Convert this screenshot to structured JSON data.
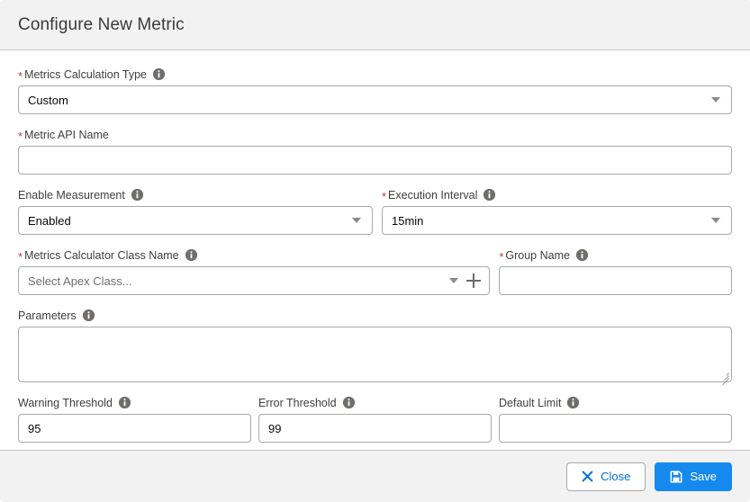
{
  "header": {
    "title": "Configure New Metric"
  },
  "form": {
    "metrics_calculation_type": {
      "label": "Metrics Calculation Type",
      "required": true,
      "has_info": true,
      "value": "Custom",
      "control": "select"
    },
    "metric_api_name": {
      "label": "Metric API Name",
      "required": true,
      "has_info": false,
      "value": "",
      "placeholder": "",
      "control": "text"
    },
    "enable_measurement": {
      "label": "Enable Measurement",
      "required": false,
      "has_info": true,
      "value": "Enabled",
      "control": "select"
    },
    "execution_interval": {
      "label": "Execution Interval",
      "required": true,
      "has_info": true,
      "value": "15min",
      "control": "select"
    },
    "metrics_calculator_class_name": {
      "label": "Metrics Calculator Class Name",
      "required": true,
      "has_info": true,
      "value": "",
      "placeholder": "Select Apex Class...",
      "control": "lookup",
      "add_button": "+"
    },
    "group_name": {
      "label": "Group Name",
      "required": true,
      "has_info": true,
      "value": "",
      "placeholder": "",
      "control": "text"
    },
    "parameters": {
      "label": "Parameters",
      "required": false,
      "has_info": true,
      "value": "",
      "placeholder": "",
      "control": "textarea"
    },
    "warning_threshold": {
      "label": "Warning Threshold",
      "required": false,
      "has_info": true,
      "value": "95",
      "control": "text"
    },
    "error_threshold": {
      "label": "Error Threshold",
      "required": false,
      "has_info": true,
      "value": "99",
      "control": "text"
    },
    "default_limit": {
      "label": "Default Limit",
      "required": false,
      "has_info": true,
      "value": "",
      "placeholder": "",
      "control": "text"
    }
  },
  "footer": {
    "close_label": "Close",
    "save_label": "Save"
  },
  "colors": {
    "brand_blue": "#1589ee",
    "link_blue": "#0070d2",
    "required_red": "#c23934",
    "header_bg": "#f3f2f2",
    "border_gray": "#a8a8a8"
  }
}
